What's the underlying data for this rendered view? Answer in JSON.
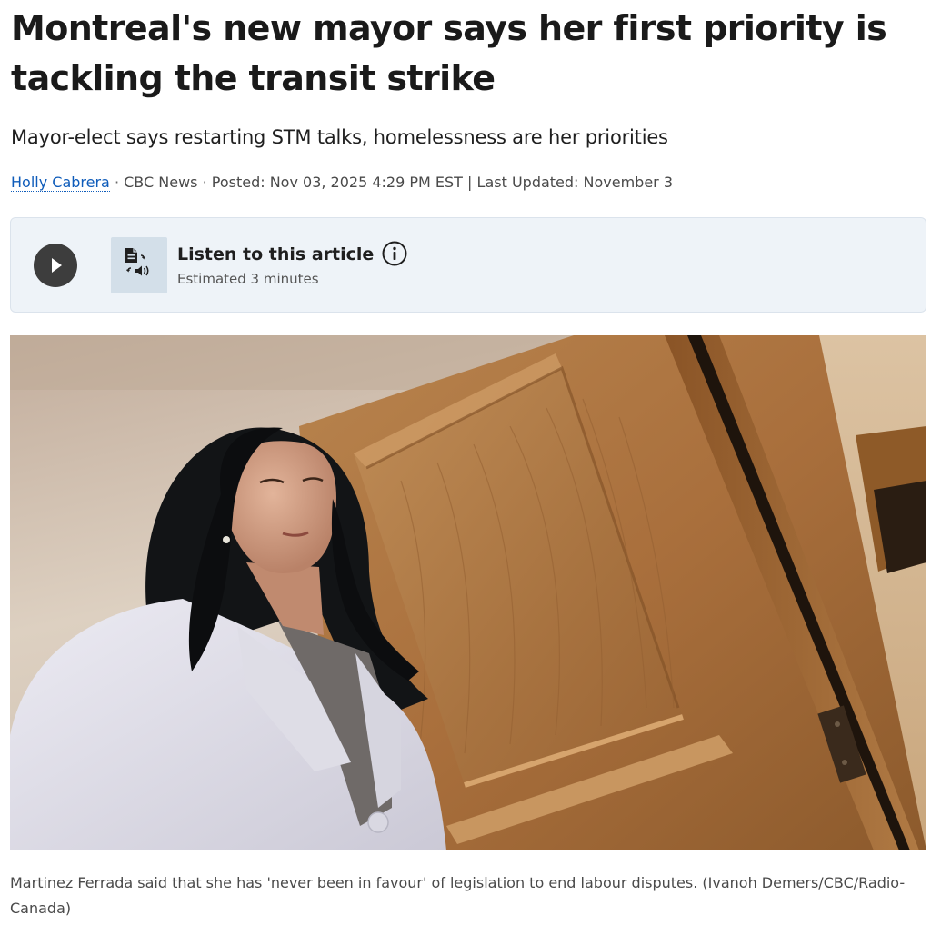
{
  "article": {
    "headline": "Montreal's new mayor says her first priority is tackling the transit strike",
    "deck": "Mayor-elect says restarting STM talks, homelessness are her priorities",
    "byline": {
      "author": "Holly Cabrera",
      "outlet": "CBC News",
      "posted": "Posted: Nov 03, 2025 4:29 PM EST",
      "divider": "|",
      "updated": "Last Updated: November 3"
    }
  },
  "listen": {
    "title": "Listen to this article",
    "duration": "Estimated 3 minutes",
    "play_icon": "play-icon",
    "audio_icon": "document-audio-icon",
    "info_icon": "info-icon"
  },
  "photo": {
    "caption": "Martinez Ferrada said that she has 'never been in favour' of legislation to end labour disputes.  (Ivanoh Demers/CBC/Radio-Canada)"
  },
  "colors": {
    "link": "#0f5cba",
    "listen_bg": "#eef3f8",
    "play_button": "#3d3d3d"
  }
}
